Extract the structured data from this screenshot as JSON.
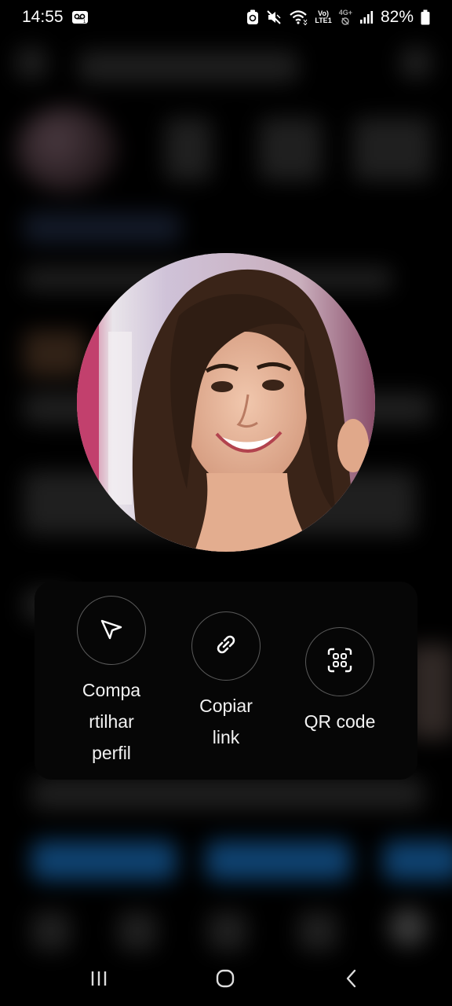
{
  "status_bar": {
    "time": "14:55",
    "network_top": "Vo)",
    "network_bottom": "LTE1",
    "network_gen": "4G+",
    "battery": "82%"
  },
  "profile": {
    "photo_icon": "profile-photo"
  },
  "share_sheet": {
    "actions": [
      {
        "label_lines": [
          "Compa",
          "rtilhar",
          "perfil"
        ],
        "icon": "send-icon"
      },
      {
        "label_lines": [
          "Copiar",
          "link"
        ],
        "icon": "link-icon"
      },
      {
        "label_lines": [
          "QR code"
        ],
        "icon": "qr-code-icon"
      }
    ]
  },
  "nav_bar": {
    "recents_icon": "recents-icon",
    "home_icon": "home-icon",
    "back_icon": "back-icon"
  }
}
